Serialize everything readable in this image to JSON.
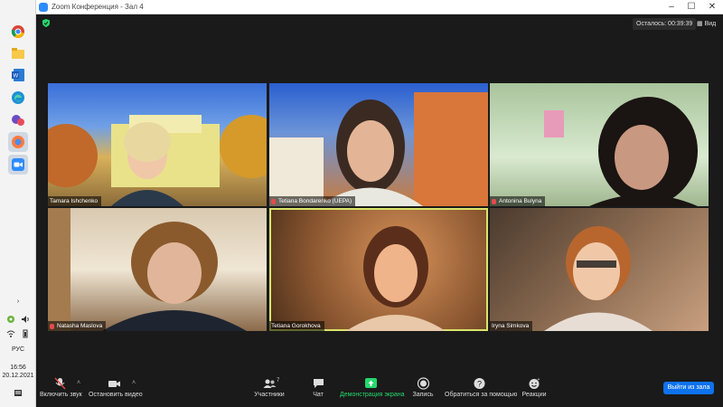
{
  "window": {
    "title": "Zoom Конференция - Зал 4"
  },
  "topbar": {
    "timer": "Осталось: 00:39:39",
    "view": "Вид"
  },
  "participants": [
    {
      "name": "Tamara Ishchenko",
      "bg": "#b48a4a"
    },
    {
      "name": "Tetiana Bondarenko (UEPA)",
      "bg": "#6b84a6"
    },
    {
      "name": "Antonina Bulyna",
      "bg": "#9dbb94"
    },
    {
      "name": "Natasha Maslova",
      "bg": "#8a7460"
    },
    {
      "name": "Tetiana Gorokhova",
      "bg": "#7a5a40"
    },
    {
      "name": "Iryna Simkova",
      "bg": "#5a4a3a"
    }
  ],
  "controls": {
    "audio": "Включить звук",
    "video": "Остановить видео",
    "participants": "Участники",
    "participants_count": "7",
    "chat": "Чат",
    "share": "Демонстрация экрана",
    "record": "Запись",
    "help": "Обратиться за помощью",
    "reactions": "Реакции",
    "leave": "Выйти из зала"
  },
  "tray": {
    "lang": "РУС",
    "time": "16:56",
    "date": "20.12.2021"
  },
  "colors": {
    "share_green": "#23d96c",
    "leave_blue": "#0e72ed",
    "active_border": "#d8e46a"
  }
}
